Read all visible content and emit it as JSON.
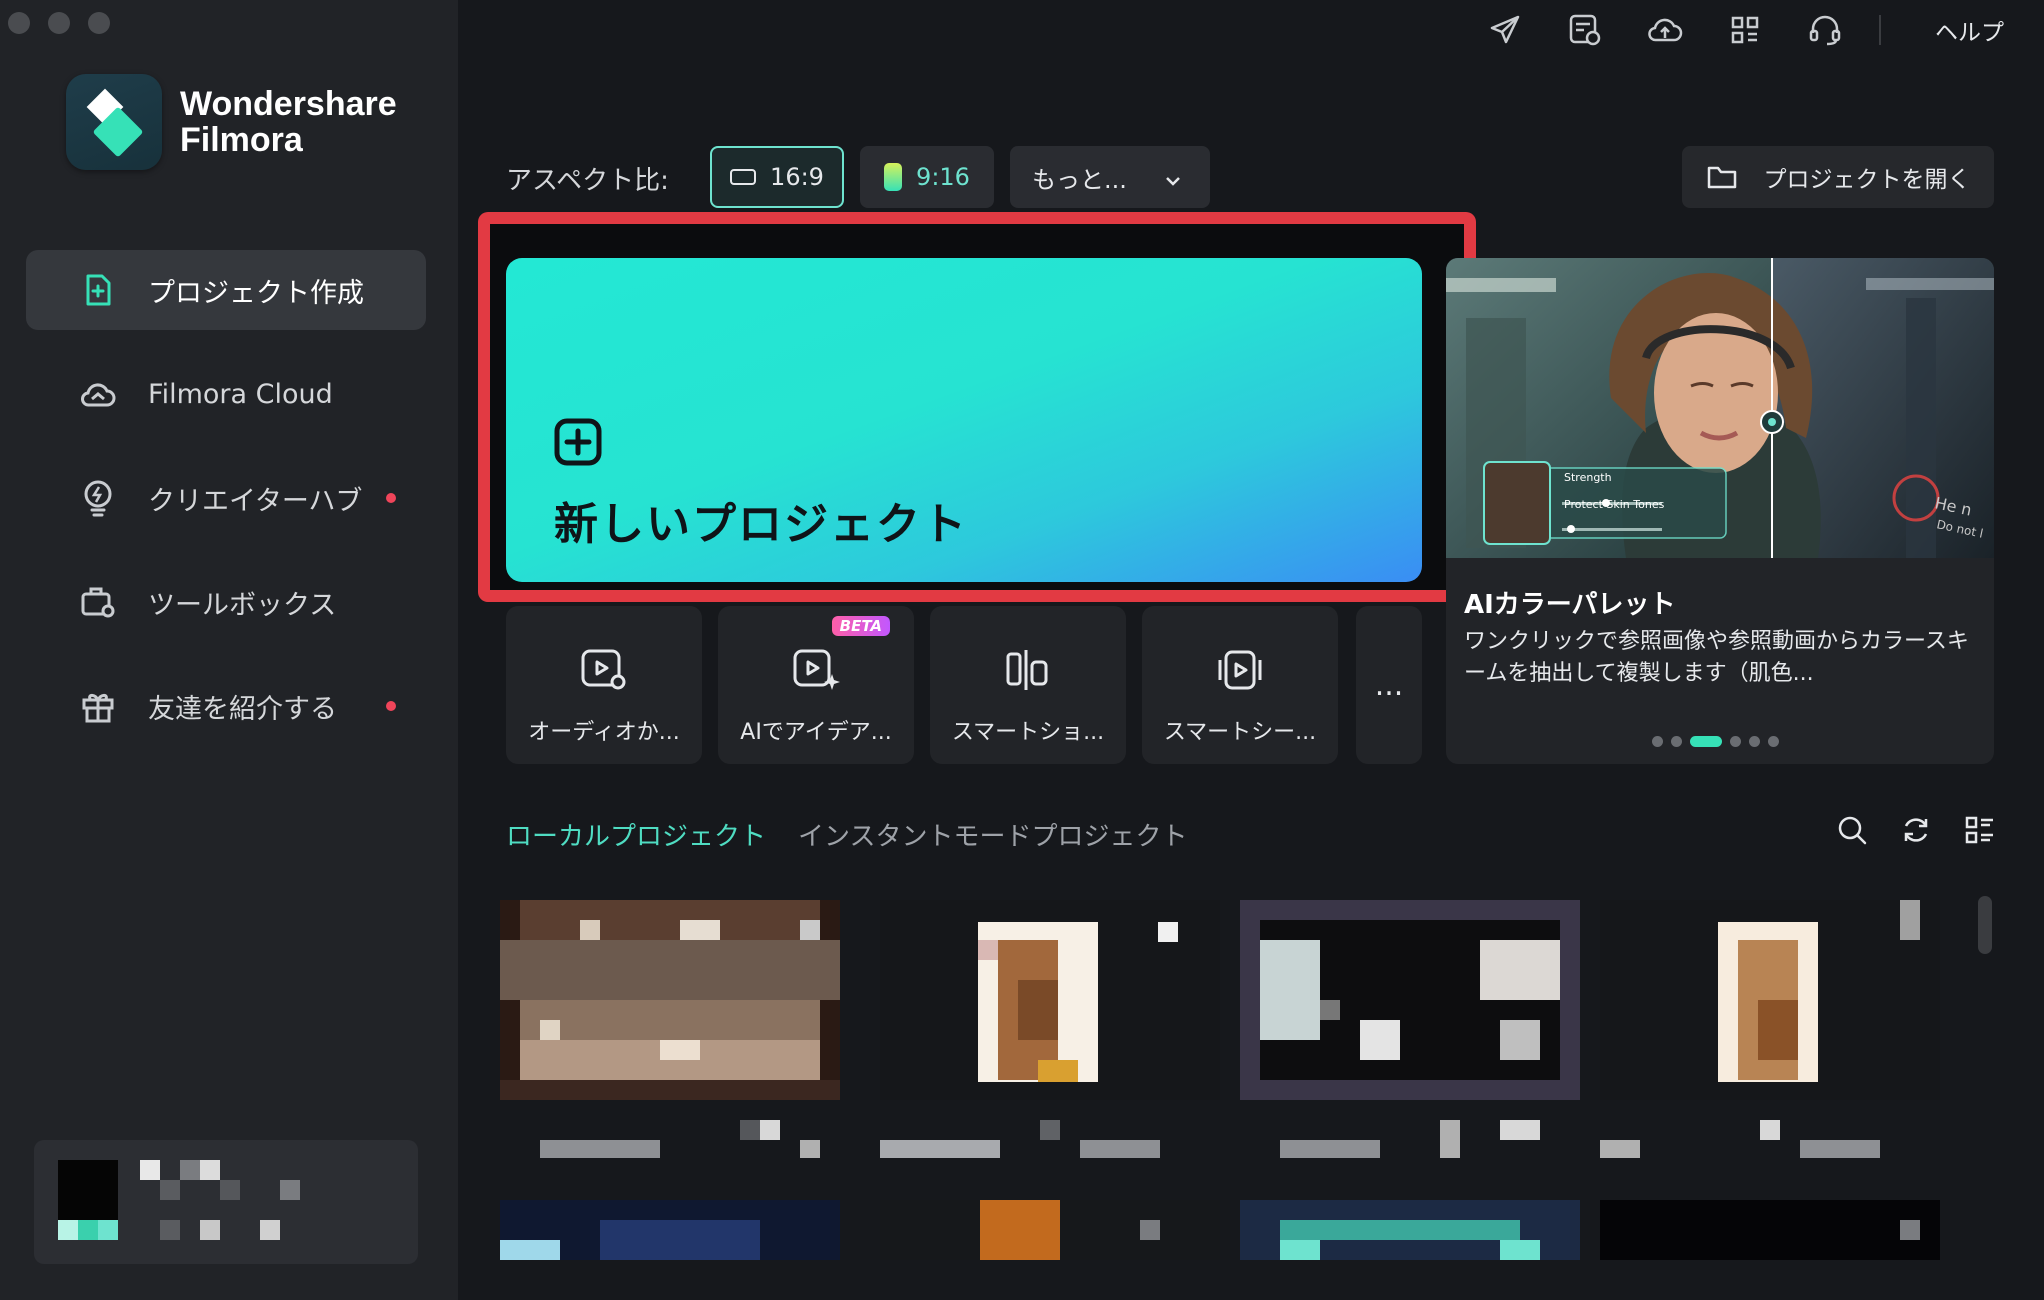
{
  "app": {
    "brand_line1": "Wondershare",
    "brand_line2": "Filmora"
  },
  "sidebar": {
    "items": [
      {
        "label": "プロジェクト作成",
        "icon": "new-project-icon",
        "active": true,
        "dot": false
      },
      {
        "label": "Filmora Cloud",
        "icon": "cloud-icon",
        "active": false,
        "dot": false
      },
      {
        "label": "クリエイターハブ",
        "icon": "lightbulb-icon",
        "active": false,
        "dot": true
      },
      {
        "label": "ツールボックス",
        "icon": "toolbox-icon",
        "active": false,
        "dot": false
      },
      {
        "label": "友達を紹介する",
        "icon": "gift-icon",
        "active": false,
        "dot": true
      }
    ]
  },
  "topbar": {
    "icons": [
      "send-icon",
      "schedule-icon",
      "cloud-upload-icon",
      "apps-grid-icon",
      "headset-icon"
    ],
    "help_label": "ヘルプ"
  },
  "aspect": {
    "label": "アスペクト比:",
    "options": [
      {
        "label": "16:9",
        "selected": true
      },
      {
        "label": "9:16",
        "selected": false
      },
      {
        "label": "もっと...",
        "selected": false
      }
    ],
    "open_project_label": "プロジェクトを開く"
  },
  "new_project": {
    "label": "新しいプロジェクト"
  },
  "tools": [
    {
      "label": "オーディオか...",
      "icon": "audio-video-icon",
      "beta": false
    },
    {
      "label": "AIでアイデア...",
      "icon": "ai-idea-icon",
      "beta": true
    },
    {
      "label": "スマートショ...",
      "icon": "smart-short-icon",
      "beta": false
    },
    {
      "label": "スマートシー...",
      "icon": "smart-scene-icon",
      "beta": false
    }
  ],
  "tools_more": "...",
  "beta_label": "BETA",
  "promo": {
    "title": "AIカラーパレット",
    "description": "ワンクリックで参照画像や参照動画からカラースキームを抽出して複製します（肌色...",
    "overlay_strength": "Strength",
    "overlay_protect": "Protect Skin Tones",
    "slide_index": 3,
    "slide_count": 6
  },
  "projects": {
    "tabs": [
      {
        "label": "ローカルプロジェクト",
        "active": true
      },
      {
        "label": "インスタントモードプロジェクト",
        "active": false
      }
    ],
    "icons": [
      "search-icon",
      "refresh-icon",
      "list-view-icon"
    ]
  },
  "colors": {
    "accent": "#36e1b7",
    "highlight_border": "#e23a43",
    "background": "#16181c",
    "sidebar": "#212327"
  }
}
